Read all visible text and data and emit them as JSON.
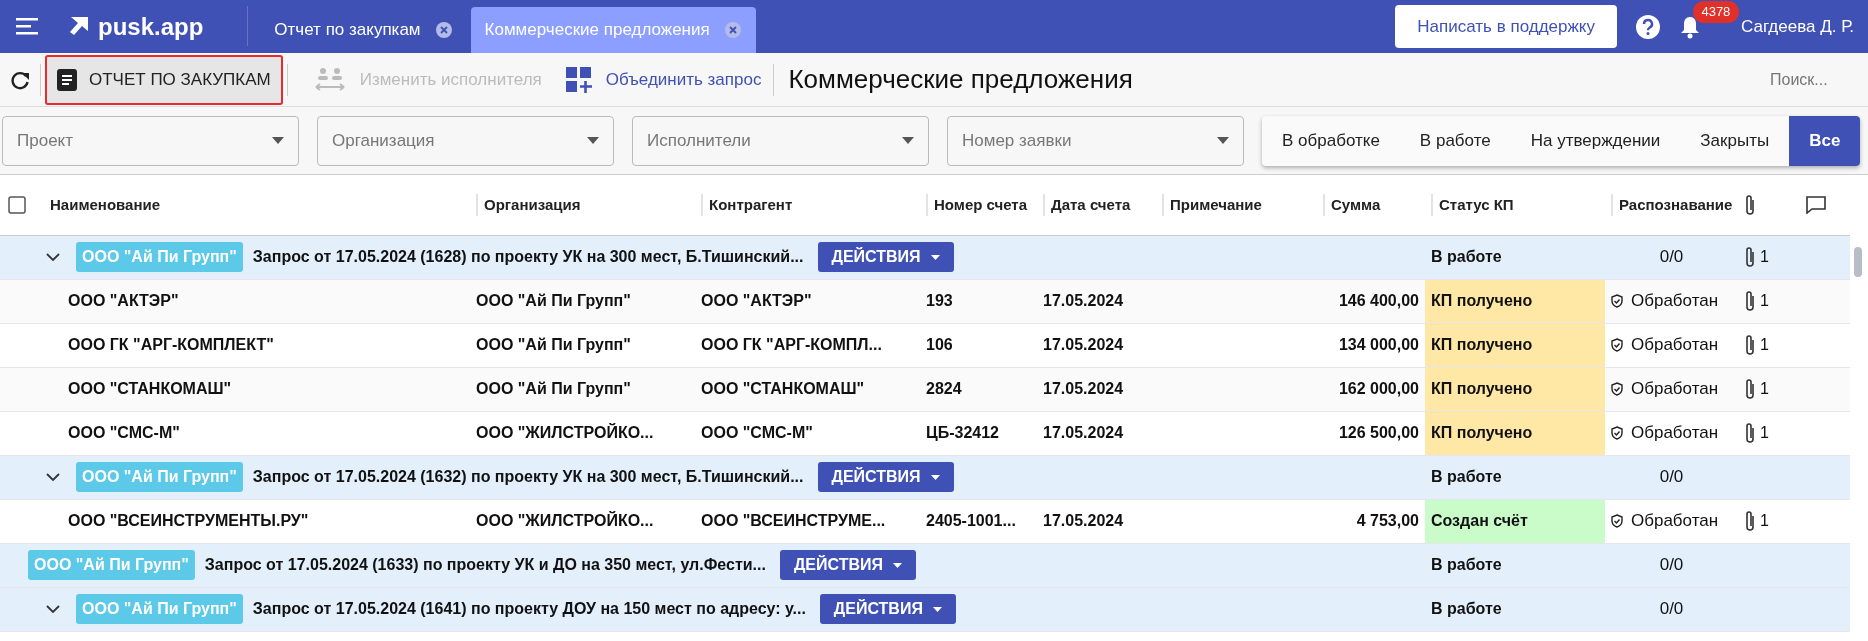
{
  "topbar": {
    "logo_text": "pusk.app",
    "tabs": [
      {
        "label": "Отчет по закупкам",
        "selected": false
      },
      {
        "label": "Коммерческие предложения",
        "selected": true
      }
    ],
    "support_button": "Написать в поддержку",
    "notification_count": "4378",
    "user": "Сагдеева Д. Р."
  },
  "toolbar": {
    "report_button": {
      "label": "ОТЧЕТ ПО ЗАКУПКАМ",
      "highlighted": true
    },
    "change_executor": {
      "label": "Изменить исполнителя",
      "disabled": true
    },
    "merge_request": {
      "label": "Объединить запрос",
      "disabled": false
    },
    "title": "Коммерческие предложения",
    "search": {
      "placeholder": "Поиск..."
    }
  },
  "filters": [
    {
      "placeholder": "Проект"
    },
    {
      "placeholder": "Организация"
    },
    {
      "placeholder": "Исполнители"
    },
    {
      "placeholder": "Номер заявки"
    }
  ],
  "status_tabs": [
    {
      "label": "В обработке",
      "selected": false
    },
    {
      "label": "В работе",
      "selected": false
    },
    {
      "label": "На утверждении",
      "selected": false
    },
    {
      "label": "Закрыты",
      "selected": false
    },
    {
      "label": "Все",
      "selected": true
    }
  ],
  "table": {
    "columns": [
      "Наименование",
      "Организация",
      "Контрагент",
      "Номер счета",
      "Дата счета",
      "Примечание",
      "Сумма",
      "Статус КП",
      "Распознавание"
    ],
    "select_all": {
      "checked": false
    },
    "rows": [
      {
        "kind": "group",
        "expanded": true,
        "tag": "ООО \"Ай Пи Групп\"",
        "title": "Запрос от 17.05.2024 (1628) по проекту УК на 300 мест, Б.Тишинский...",
        "action": "ДЕЙСТВИЯ",
        "status": "В работе",
        "recognition": "0/0",
        "attachments": "1"
      },
      {
        "kind": "item",
        "name": "ООО \"АКТЭР\"",
        "organization": "ООО \"Ай Пи Групп\"",
        "counterparty": "ООО \"АКТЭР\"",
        "invoice_number": "193",
        "invoice_date": "17.05.2024",
        "sum": "146 400,00",
        "status": "КП получено",
        "color": "#ffe8a5",
        "recognition": "Обработан",
        "attachments": "1"
      },
      {
        "kind": "item",
        "name": "ООО ГК \"АРГ-КОМПЛЕКТ\"",
        "organization": "ООО \"Ай Пи Групп\"",
        "counterparty": "ООО ГК \"АРГ-КОМПЛ...",
        "invoice_number": "106",
        "invoice_date": "17.05.2024",
        "sum": "134 000,00",
        "status": "КП получено",
        "color": "#ffe8a5",
        "recognition": "Обработан",
        "attachments": "1"
      },
      {
        "kind": "item",
        "name": "ООО \"СТАНКОМАШ\"",
        "organization": "ООО \"Ай Пи Групп\"",
        "counterparty": "ООО \"СТАНКОМАШ\"",
        "invoice_number": "2824",
        "invoice_date": "17.05.2024",
        "sum": "162 000,00",
        "status": "КП получено",
        "color": "#ffe8a5",
        "recognition": "Обработан",
        "attachments": "1"
      },
      {
        "kind": "item",
        "name": "ООО \"СМС-М\"",
        "organization": "ООО \"ЖИЛСТРОЙКО...",
        "counterparty": "ООО \"СМС-М\"",
        "invoice_number": "ЦБ-32412",
        "invoice_date": "17.05.2024",
        "sum": "126 500,00",
        "status": "КП получено",
        "color": "#ffe8a5",
        "recognition": "Обработан",
        "attachments": "1"
      },
      {
        "kind": "group",
        "expanded": true,
        "tag": "ООО \"Ай Пи Групп\"",
        "title": "Запрос от 17.05.2024 (1632) по проекту УК на 300 мест, Б.Тишинский...",
        "action": "ДЕЙСТВИЯ",
        "status": "В работе",
        "recognition": "0/0"
      },
      {
        "kind": "item",
        "name": "ООО \"ВСЕИНСТРУМЕНТЫ.РУ\"",
        "organization": "ООО \"ЖИЛСТРОЙКО...",
        "counterparty": "ООО \"ВСЕИНСТРУМЕ...",
        "invoice_number": "2405-1001...",
        "invoice_date": "17.05.2024",
        "sum": "4 753,00",
        "status": "Создан счёт",
        "color": "#c9fcc9",
        "recognition": "Обработан",
        "attachments": "1"
      },
      {
        "kind": "group",
        "tag": "ООО \"Ай Пи Групп\"",
        "title": "Запрос от 17.05.2024 (1633) по проекту УК и ДО на 350 мест, ул.Фести...",
        "action": "ДЕЙСТВИЯ",
        "status": "В работе",
        "recognition": "0/0"
      },
      {
        "kind": "group",
        "expanded": true,
        "tag": "ООО \"Ай Пи Групп\"",
        "title": "Запрос от 17.05.2024 (1641) по проекту ДОУ на 150 мест по адресу: у...",
        "action": "ДЕЙСТВИЯ",
        "status": "В работе",
        "recognition": "0/0"
      }
    ]
  }
}
